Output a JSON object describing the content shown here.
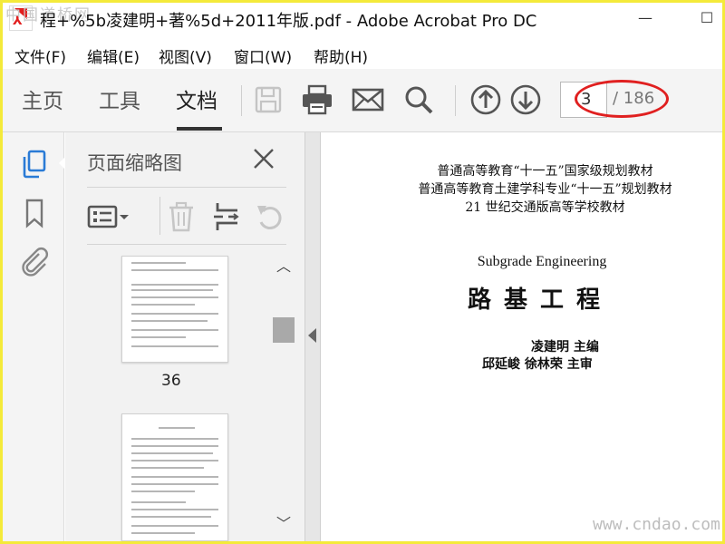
{
  "window": {
    "title": "程+%5b凌建明+著%5d+2011年版.pdf - Adobe Acrobat Pro DC",
    "watermark_top": "中国道桥网",
    "minimize_glyph": "—",
    "maximize_glyph": "☐"
  },
  "menu": [
    "文件(F)",
    "编辑(E)",
    "视图(V)",
    "窗口(W)",
    "帮助(H)"
  ],
  "toolbar": {
    "tabs": [
      "主页",
      "工具",
      "文档"
    ],
    "active_tab": "文档",
    "icons": [
      "save-icon",
      "print-icon",
      "email-icon",
      "search-icon",
      "page-up-icon",
      "page-down-icon"
    ],
    "page_current": "3",
    "page_total": "/ 186",
    "highlight_color": "#e02020"
  },
  "rail": {
    "icons": [
      "page-thumbnails-icon",
      "bookmarks-icon",
      "attachments-icon"
    ],
    "accent": "#2a7bd6"
  },
  "panel": {
    "title": "页面缩略图",
    "tools": [
      "thumbnail-options-icon",
      "delete-icon",
      "extract-icon",
      "rotate-icon"
    ],
    "thumbnail_label": "36"
  },
  "document": {
    "heading_lines": [
      "普通高等教育“十一五”国家级规划教材",
      "普通高等教育土建学科专业“十一五”规划教材",
      "21 世纪交通版高等学校教材"
    ],
    "english_title": "Subgrade Engineering",
    "chinese_title": "路基工程",
    "author_line": "凌建明  主编",
    "reviewer_line": "邱延峻  徐林荣  主审"
  },
  "watermark_bottom": "www.cndao.com",
  "frame_color": "#f4ea3a"
}
